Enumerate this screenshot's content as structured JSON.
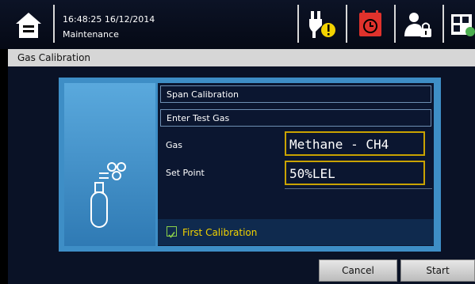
{
  "topbar": {
    "time": "16:48:25 16/12/2014",
    "mode": "Maintenance",
    "icons": [
      "home-icon",
      "power-warning-icon",
      "calendar-alarm-icon",
      "user-lock-icon",
      "grid-refresh-icon"
    ]
  },
  "window": {
    "title": "Gas Calibration"
  },
  "form": {
    "section_title": "Span Calibration",
    "subtitle": "Enter Test Gas",
    "gas_label": "Gas",
    "gas_value": "Methane - CH4",
    "setpoint_label": "Set Point",
    "setpoint_value": "50%LEL",
    "first_calibration_label": "First Calibration",
    "first_calibration_checked": true
  },
  "buttons": {
    "cancel": "Cancel",
    "start": "Start"
  },
  "colors": {
    "accent_yellow": "#f2d200",
    "field_border": "#c9a300",
    "alarm_red": "#e0322c",
    "panel_blue": "#3e8ec6"
  }
}
